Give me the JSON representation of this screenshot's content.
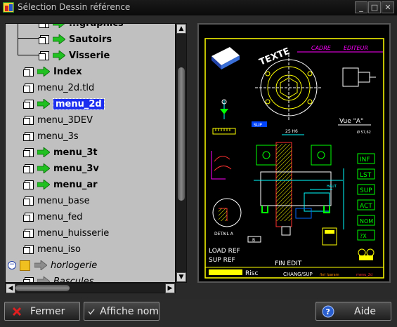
{
  "window": {
    "title": "Sélection Dessin référence",
    "minimize": "_",
    "maximize": "□",
    "close": "✕"
  },
  "tree": {
    "items": [
      {
        "label": "...graphics",
        "level": 2,
        "icon": "doc",
        "arrow": "green",
        "bold": true
      },
      {
        "label": "Sautoirs",
        "level": 2,
        "icon": "doc",
        "arrow": "green",
        "bold": true
      },
      {
        "label": "Visserie",
        "level": 2,
        "icon": "doc",
        "arrow": "green",
        "bold": true
      },
      {
        "label": "Index",
        "level": 1,
        "icon": "doc",
        "arrow": "green",
        "bold": true
      },
      {
        "label": "menu_2d.tld",
        "level": 1,
        "icon": "doc"
      },
      {
        "label": "menu_2d",
        "level": 1,
        "icon": "doc",
        "arrow": "green",
        "bold": true,
        "selected": true
      },
      {
        "label": "menu_3DEV",
        "level": 1,
        "icon": "doc"
      },
      {
        "label": "menu_3s",
        "level": 1,
        "icon": "doc"
      },
      {
        "label": "menu_3t",
        "level": 1,
        "icon": "doc",
        "arrow": "green",
        "bold": true
      },
      {
        "label": "menu_3v",
        "level": 1,
        "icon": "doc",
        "arrow": "green",
        "bold": true
      },
      {
        "label": "menu_ar",
        "level": 1,
        "icon": "doc",
        "arrow": "green",
        "bold": true
      },
      {
        "label": "menu_base",
        "level": 1,
        "icon": "doc"
      },
      {
        "label": "menu_fed",
        "level": 1,
        "icon": "doc"
      },
      {
        "label": "menu_huisserie",
        "level": 1,
        "icon": "doc"
      },
      {
        "label": "menu_iso",
        "level": 1,
        "icon": "doc"
      },
      {
        "label": "horlogerie",
        "level": 0,
        "icon": "folder",
        "arrow": "gray",
        "italic": true,
        "expander": "−"
      },
      {
        "label": "Bascules",
        "level": 1,
        "icon": "doc",
        "arrow": "gray",
        "italic": true
      }
    ]
  },
  "drawing": {
    "texte": "TEXTE",
    "cadre": "CADRE",
    "editeur": "EDITEUR",
    "vue": "Vue \"A\"",
    "sup": "SUP",
    "dim1": "25 H6",
    "dim2": "Ø 57,62",
    "detail": "DETAIL A",
    "rect_b": "B",
    "hauteur": "HAUT",
    "menu_buttons": [
      "INF",
      "LST",
      "SUP",
      "ACT",
      "NOM",
      "?X"
    ],
    "load_ref": "LOAD REF",
    "sup_ref": "SUP REF",
    "fin_edit": "FIN EDIT",
    "risc": "Risc",
    "chang_sup": "CHANG/SUP",
    "tail_path": "/tel /param",
    "menu_name": "menu_2d",
    "colors": {
      "frame": "#ffff00",
      "accent": "#ff00ff",
      "lines": "#00ffff",
      "green": "#00ff00",
      "red": "#ff3030",
      "white": "#ffffff"
    }
  },
  "footer": {
    "fermer": "Fermer",
    "affiche_nom": "Affiche nom",
    "aide": "Aide"
  },
  "icons": {
    "fermer": "red-x-icon",
    "affiche_nom": "checkmark-icon",
    "aide": "help-icon"
  }
}
